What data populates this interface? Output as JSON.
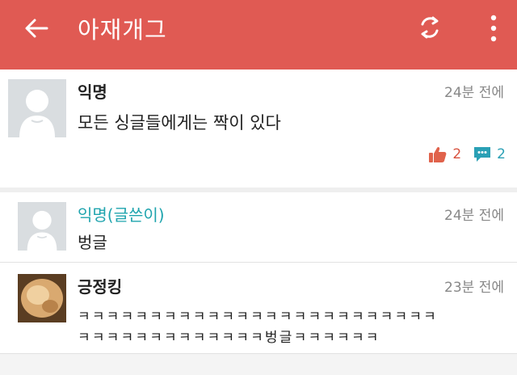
{
  "appbar": {
    "title": "아재개그",
    "back_icon": "arrow-left-icon",
    "refresh_icon": "refresh-icon",
    "more_icon": "more-vert-icon",
    "color": "#e05a53"
  },
  "post": {
    "author": "익명",
    "time": "24분 전에",
    "body": "모든 싱글들에게는 짝이 있다",
    "likes": "2",
    "comments": "2",
    "like_icon": "thumbs-up-icon",
    "comment_icon": "chat-bubble-icon"
  },
  "comments": [
    {
      "author": "익명(글쓴이)",
      "time": "24분 전에",
      "body": "벙글"
    },
    {
      "author": "긍정킹",
      "time": "23분 전에",
      "line1": "ㅋㅋㅋㅋㅋㅋㅋㅋㅋㅋㅋㅋㅋㅋㅋㅋㅋㅋㅋㅋㅋㅋㅋㅋㅋ",
      "line2": "ㅋㅋㅋㅋㅋㅋㅋㅋㅋㅋㅋㅋㅋ벙글ㅋㅋㅋㅋㅋㅋ"
    }
  ]
}
